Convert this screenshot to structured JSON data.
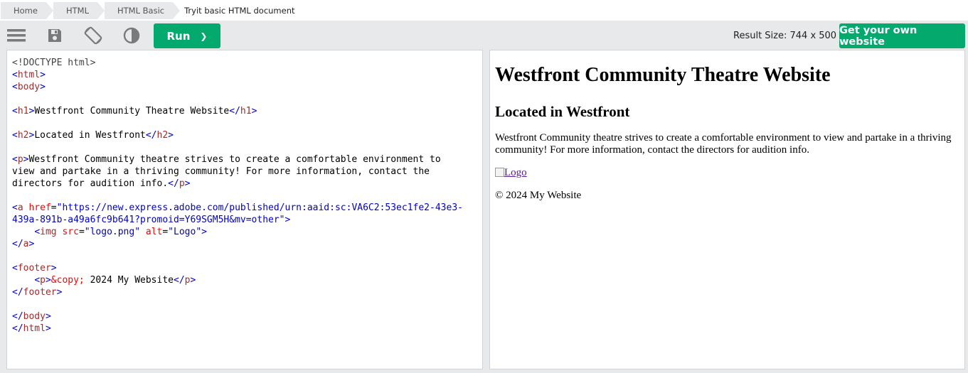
{
  "breadcrumb": {
    "items": [
      "Home",
      "HTML",
      "HTML Basic"
    ],
    "current": "Tryit basic HTML document"
  },
  "toolbar": {
    "icons": [
      "menu-icon",
      "save-icon",
      "rotate-icon",
      "contrast-icon"
    ],
    "run_label": "Run",
    "run_chevron": "❯",
    "result_size": "Result Size: 744 x 500",
    "own_website_label": "Get your own website"
  },
  "editor": {
    "doctype": "<!DOCTYPE html>",
    "h1_text": "Westfront Community Theatre Website",
    "h2_text": "Located in Westfront",
    "p_line1": "Westfront Community theatre strives to create a comfortable environment to",
    "p_line2": "view and partake in a thriving community! For more information, contact the",
    "p_line3": "directors for audition info.",
    "href_line1": "\"https://new.express.adobe.com/published/urn:aaid:sc:VA6C2:53ec1fe2-43e3-",
    "href_line2": "439a-891b-a49a6fc9b641?promoid=Y69SGM5H&mv=other\"",
    "img_src": "\"logo.png\"",
    "img_alt": "\"Logo\"",
    "footer_entity": "&copy;",
    "footer_text": " 2024 My Website"
  },
  "result": {
    "heading": "Westfront Community Theatre Website",
    "subheading": "Located in Westfront",
    "paragraph": "Westfront Community theatre strives to create a comfortable environment to view and partake in a thriving community! For more information, contact the directors for audition info.",
    "logo_alt": "Logo",
    "footer": "© 2024 My Website"
  },
  "colors": {
    "accent": "#04aa6d",
    "toolbar_bg": "#e7e9eb",
    "tag_name": "#a52a2a",
    "bracket": "#0000cd",
    "attr_name": "#ff0000",
    "link_visited": "#551a8b"
  }
}
